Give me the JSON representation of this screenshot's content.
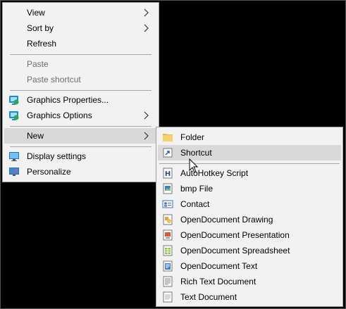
{
  "main_menu": {
    "items": [
      {
        "label": "View",
        "icon": "",
        "has_submenu": true,
        "disabled": false
      },
      {
        "label": "Sort by",
        "icon": "",
        "has_submenu": true,
        "disabled": false
      },
      {
        "label": "Refresh",
        "icon": "",
        "has_submenu": false,
        "disabled": false
      },
      {
        "label": "Paste",
        "icon": "",
        "has_submenu": false,
        "disabled": true
      },
      {
        "label": "Paste shortcut",
        "icon": "",
        "has_submenu": false,
        "disabled": true
      },
      {
        "label": "Graphics Properties...",
        "icon": "intel-graphics-icon",
        "has_submenu": false,
        "disabled": false
      },
      {
        "label": "Graphics Options",
        "icon": "intel-graphics-icon",
        "has_submenu": true,
        "disabled": false
      },
      {
        "label": "New",
        "icon": "",
        "has_submenu": true,
        "disabled": false,
        "highlighted": true
      },
      {
        "label": "Display settings",
        "icon": "display-settings-icon",
        "has_submenu": false,
        "disabled": false
      },
      {
        "label": "Personalize",
        "icon": "personalize-icon",
        "has_submenu": false,
        "disabled": false
      }
    ]
  },
  "new_submenu": {
    "items": [
      {
        "label": "Folder",
        "icon": "folder-icon"
      },
      {
        "label": "Shortcut",
        "icon": "shortcut-icon",
        "highlighted": true
      },
      {
        "label": "AutoHotkey Script",
        "icon": "autohotkey-icon"
      },
      {
        "label": "bmp File",
        "icon": "bmp-file-icon"
      },
      {
        "label": "Contact",
        "icon": "contact-icon"
      },
      {
        "label": "OpenDocument Drawing",
        "icon": "odg-icon"
      },
      {
        "label": "OpenDocument Presentation",
        "icon": "odp-icon"
      },
      {
        "label": "OpenDocument Spreadsheet",
        "icon": "ods-icon"
      },
      {
        "label": "OpenDocument Text",
        "icon": "odt-icon"
      },
      {
        "label": "Rich Text Document",
        "icon": "rtf-icon"
      },
      {
        "label": "Text Document",
        "icon": "txt-icon"
      }
    ]
  },
  "colors": {
    "menu_bg": "#f2f2f2",
    "highlight": "#d9d9d9",
    "disabled_text": "#6d6d6d",
    "desktop_bg": "#000000"
  }
}
